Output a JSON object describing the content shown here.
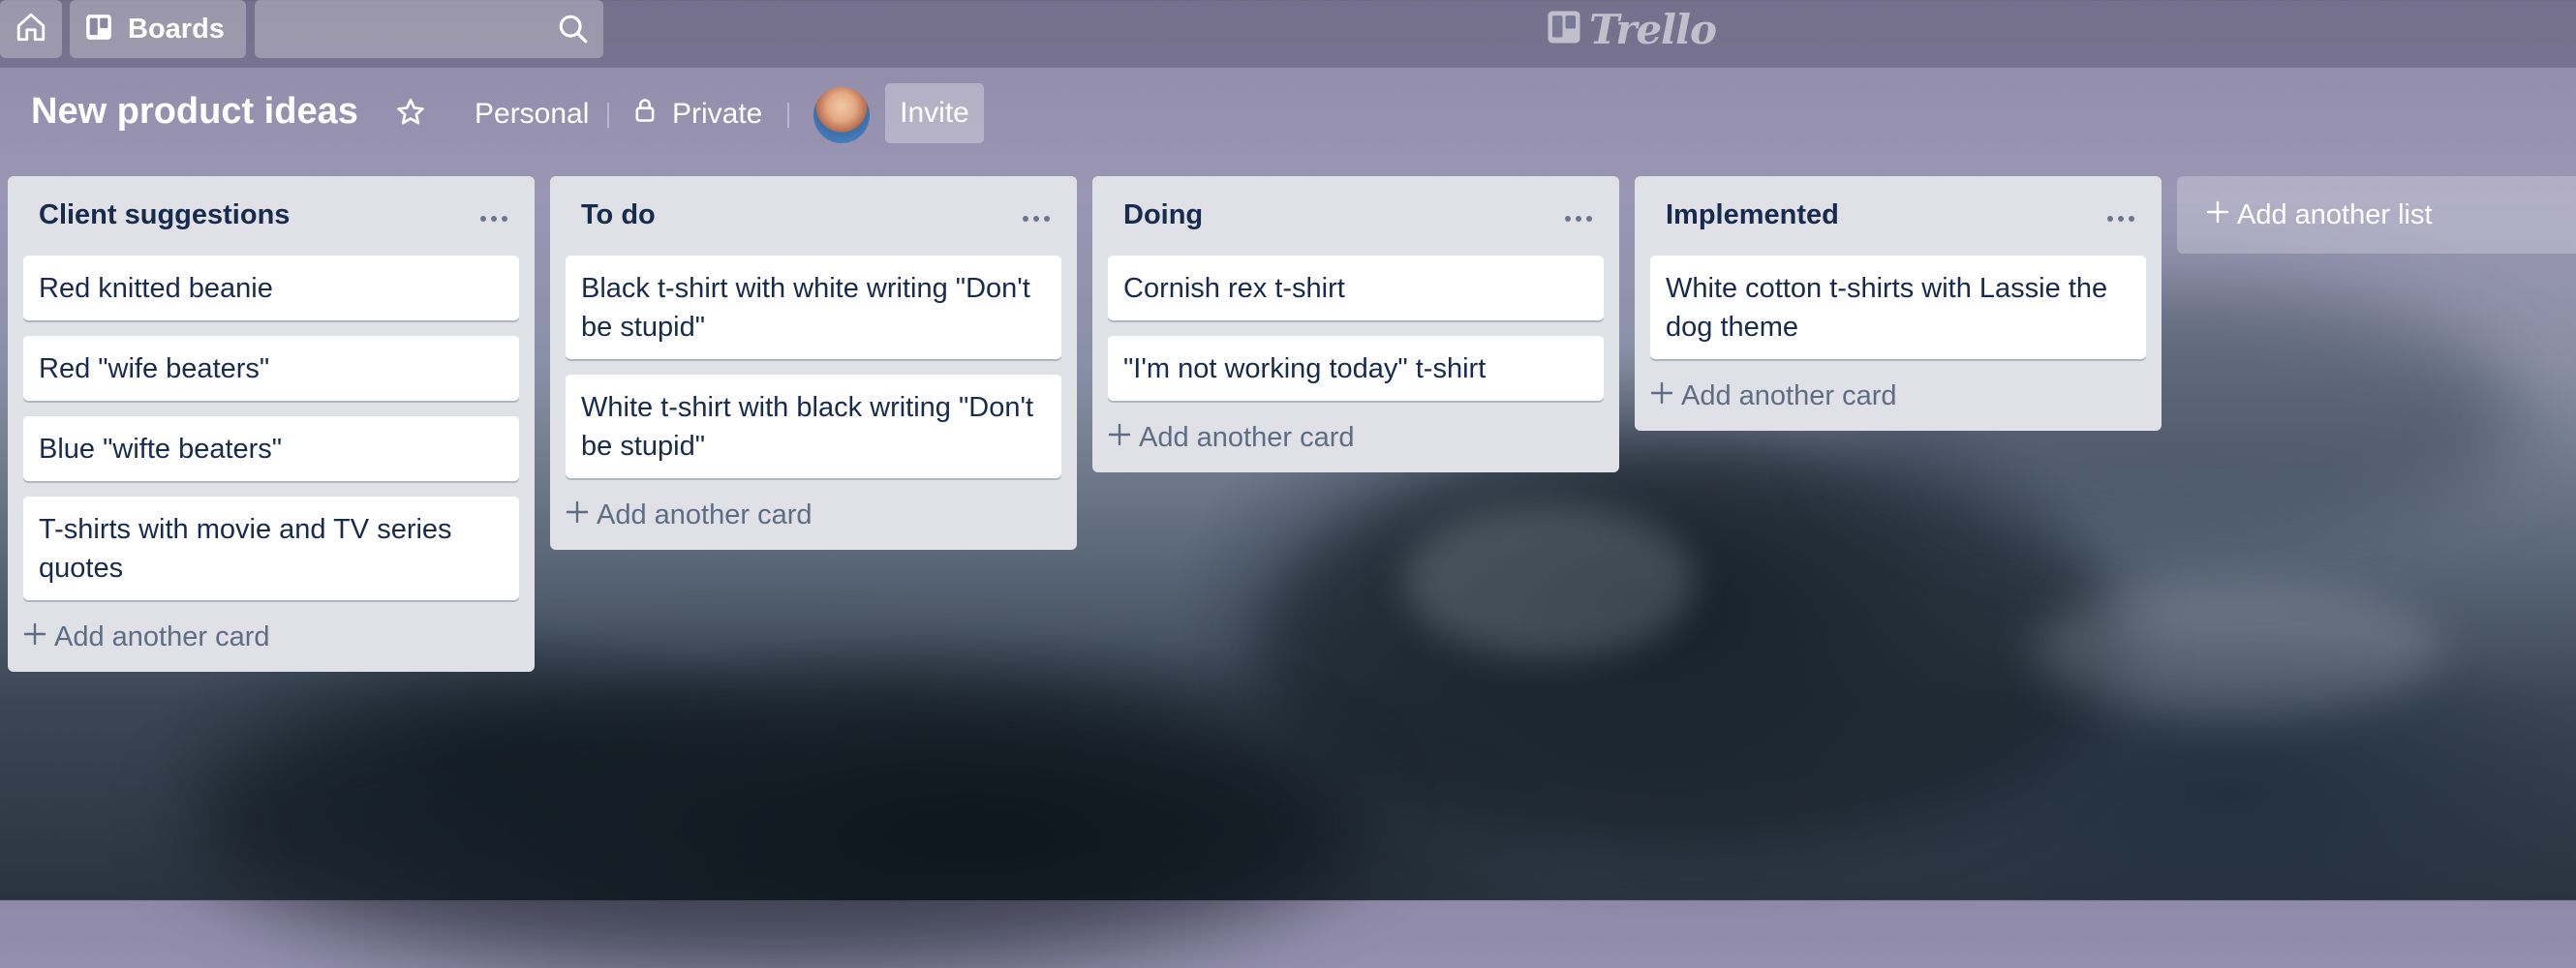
{
  "topbar": {
    "boards_label": "Boards",
    "search_value": "",
    "logo_text": "Trello"
  },
  "board": {
    "title": "New product ideas",
    "team_label": "Personal",
    "visibility_label": "Private",
    "invite_label": "Invite"
  },
  "lists": [
    {
      "title": "Client suggestions",
      "cards": [
        "Red knitted beanie",
        "Red \"wife beaters\"",
        "Blue \"wifte beaters\"",
        "T-shirts with movie and TV series quotes"
      ],
      "add_card_label": "Add another card"
    },
    {
      "title": "To do",
      "cards": [
        "Black t-shirt with white writing \"Don't be stupid\"",
        "White t-shirt with black writing \"Don't be stupid\""
      ],
      "add_card_label": "Add another card"
    },
    {
      "title": "Doing",
      "cards": [
        "Cornish rex t-shirt",
        "\"I'm not working today\" t-shirt"
      ],
      "add_card_label": "Add another card"
    },
    {
      "title": "Implemented",
      "cards": [
        "White cotton t-shirts with Lassie the dog theme"
      ],
      "add_card_label": "Add another card"
    }
  ],
  "add_list_label": "Add another list",
  "icons": {
    "home": "home-icon",
    "boards": "boards-icon",
    "search": "search-icon",
    "star": "star-icon",
    "lock": "lock-icon",
    "menu": "more-horizontal-icon",
    "plus": "plus-icon"
  },
  "colors": {
    "list_bg": "#dfe1e6",
    "card_bg": "#ffffff",
    "text": "#172b4d",
    "muted_text": "#5e6c84"
  }
}
